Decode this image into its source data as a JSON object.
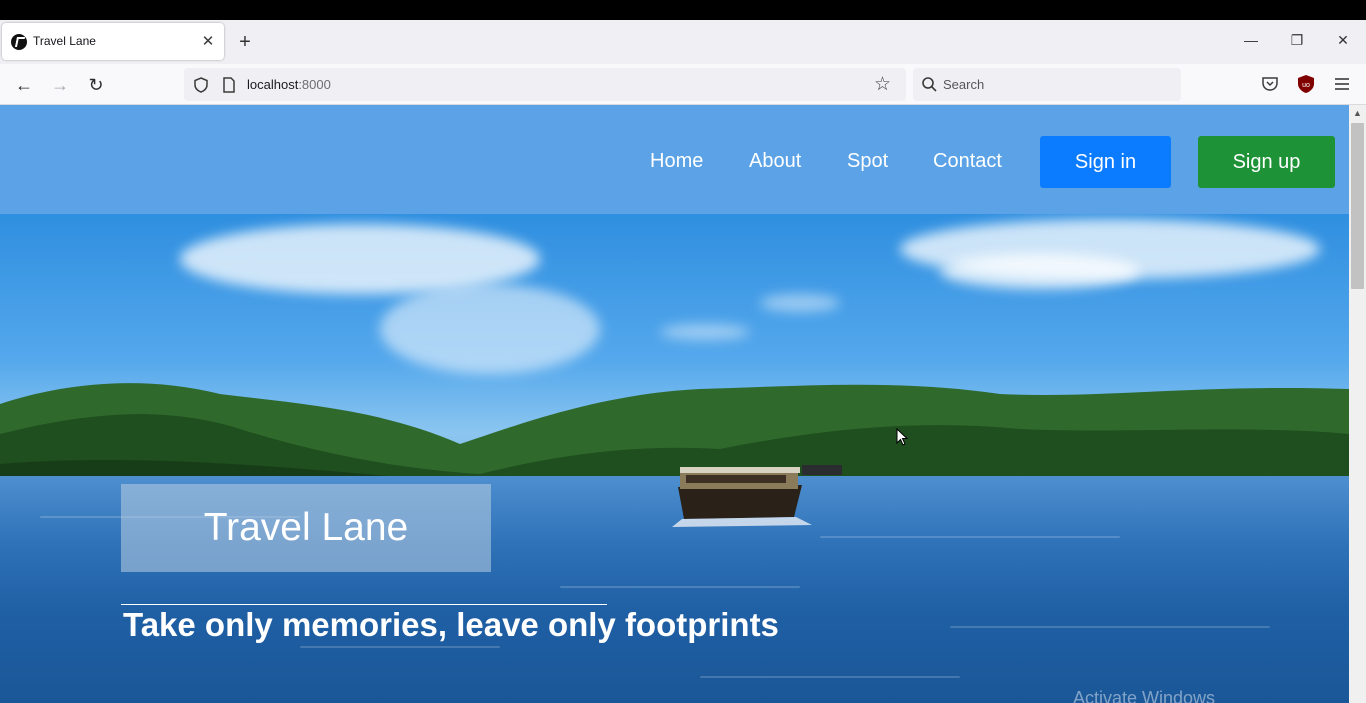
{
  "browser": {
    "tab_title": "Travel Lane",
    "url_host": "localhost",
    "url_port": ":8000",
    "search_placeholder": "Search",
    "icons": [
      "back-icon",
      "forward-icon",
      "reload-icon",
      "shield-icon",
      "page-icon",
      "star-icon",
      "search-icon",
      "pocket-icon",
      "ublock-icon",
      "menu-icon",
      "minimize-icon",
      "restore-icon",
      "close-icon",
      "new-tab-icon"
    ]
  },
  "nav": {
    "links": [
      "Home",
      "About",
      "Spot",
      "Contact"
    ],
    "signin": "Sign in",
    "signup": "Sign up"
  },
  "hero": {
    "title": "Travel Lane",
    "tagline": "Take only memories, leave only footprints"
  },
  "os": {
    "watermark": "Activate Windows"
  },
  "colors": {
    "header": "#5ba3e6",
    "signin": "#0b7cff",
    "signup": "#1e9236"
  }
}
